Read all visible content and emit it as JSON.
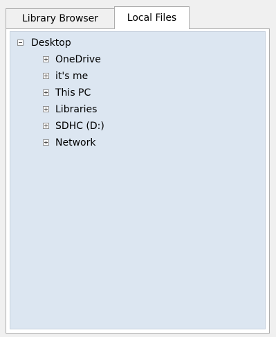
{
  "tabs": [
    {
      "label": "Library Browser",
      "active": false
    },
    {
      "label": "Local Files",
      "active": true
    }
  ],
  "tree": {
    "root": {
      "label": "Desktop",
      "expanded": true
    },
    "children": [
      {
        "label": "OneDrive",
        "expanded": false
      },
      {
        "label": "it's me",
        "expanded": false
      },
      {
        "label": "This PC",
        "expanded": false
      },
      {
        "label": "Libraries",
        "expanded": false
      },
      {
        "label": "SDHC (D:)",
        "expanded": false
      },
      {
        "label": "Network",
        "expanded": false
      }
    ]
  },
  "colors": {
    "tree_background": "#dce6f1",
    "window_background": "#f0f0f0",
    "border": "#adadad"
  }
}
